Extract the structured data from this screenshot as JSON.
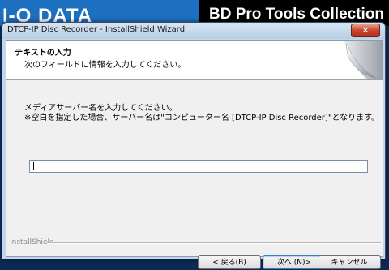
{
  "background": {
    "logo_text": "I-O DATA",
    "product_title": "BD Pro Tools Collection"
  },
  "window": {
    "title": "DTCP-IP Disc Recorder - InstallShield Wizard",
    "close_glyph": "✕"
  },
  "header": {
    "title": "テキストの入力",
    "subtitle": "次のフィールドに情報を入力してください。"
  },
  "body": {
    "instruction_line1": "メディアサーバー名を入力してください。",
    "instruction_line2": "※空白を指定した場合、サーバー名は\"コンピューター名 [DTCP-IP Disc Recorder]\"となります。",
    "server_name_value": ""
  },
  "footer": {
    "installshield_label": "InstallShield"
  },
  "buttons": {
    "back": "< 戻る(B)",
    "next": "次へ (N)>",
    "cancel": "キャンセル"
  }
}
